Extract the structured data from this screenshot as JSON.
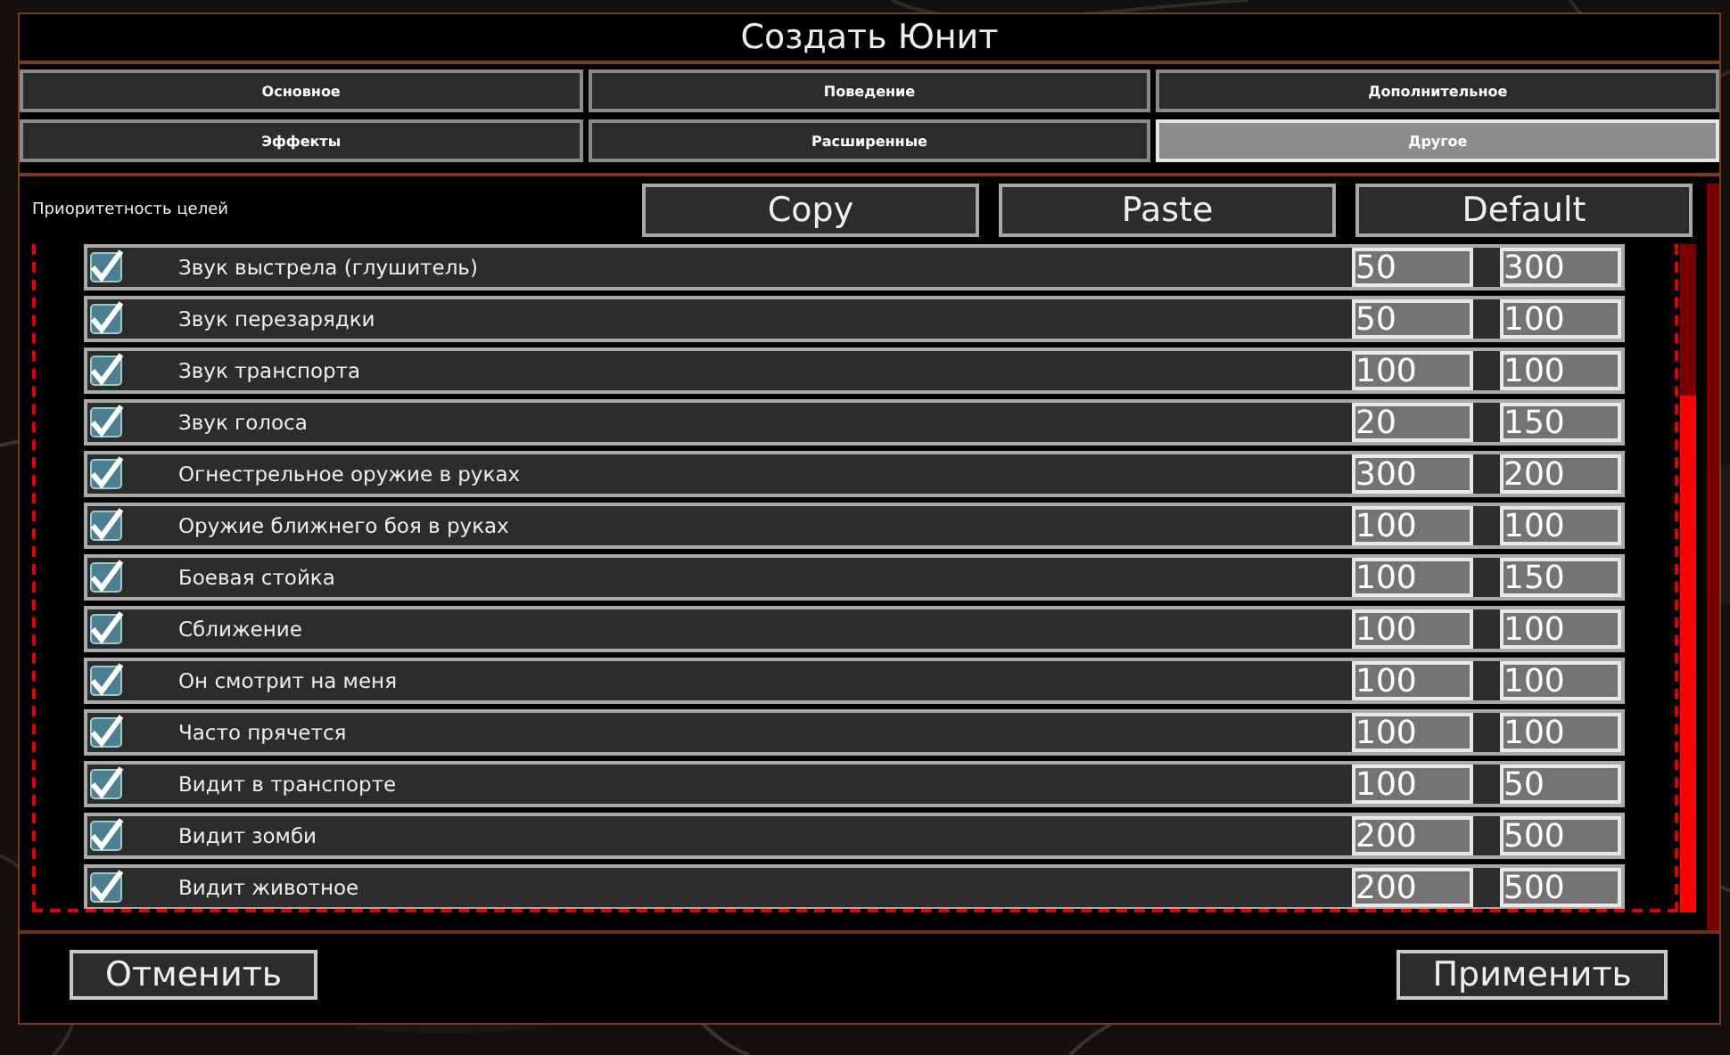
{
  "window": {
    "title": "Создать Юнит"
  },
  "tabs": [
    {
      "label": "Основное",
      "selected": false
    },
    {
      "label": "Поведение",
      "selected": false
    },
    {
      "label": "Дополнительное",
      "selected": false
    },
    {
      "label": "Эффекты",
      "selected": false
    },
    {
      "label": "Расширенные",
      "selected": false
    },
    {
      "label": "Другое",
      "selected": true
    }
  ],
  "section": {
    "label": "Приоритетность целей",
    "buttons": [
      "Copy",
      "Paste",
      "Default"
    ]
  },
  "rows": [
    {
      "label": "Звук выстрела (глушитель)",
      "checked": true,
      "value_1": "50",
      "value_2": "300"
    },
    {
      "label": "Звук перезарядки",
      "checked": true,
      "value_1": "50",
      "value_2": "100"
    },
    {
      "label": "Звук транспорта",
      "checked": true,
      "value_1": "100",
      "value_2": "100"
    },
    {
      "label": "Звук голоса",
      "checked": true,
      "value_1": "20",
      "value_2": "150"
    },
    {
      "label": "Огнестрельное оружие в руках",
      "checked": true,
      "value_1": "300",
      "value_2": "200"
    },
    {
      "label": "Оружие ближнего боя в руках",
      "checked": true,
      "value_1": "100",
      "value_2": "100"
    },
    {
      "label": "Боевая стойка",
      "checked": true,
      "value_1": "100",
      "value_2": "150"
    },
    {
      "label": "Сближение",
      "checked": true,
      "value_1": "100",
      "value_2": "100"
    },
    {
      "label": "Он смотрит на меня",
      "checked": true,
      "value_1": "100",
      "value_2": "100"
    },
    {
      "label": "Часто прячется",
      "checked": true,
      "value_1": "100",
      "value_2": "100"
    },
    {
      "label": "Видит в транспорте",
      "checked": true,
      "value_1": "100",
      "value_2": "50"
    },
    {
      "label": "Видит зомби",
      "checked": true,
      "value_1": "200",
      "value_2": "500"
    },
    {
      "label": "Видит животное",
      "checked": true,
      "value_1": "200",
      "value_2": "500"
    }
  ],
  "footer": {
    "cancel": "Отменить",
    "apply": "Применить"
  }
}
